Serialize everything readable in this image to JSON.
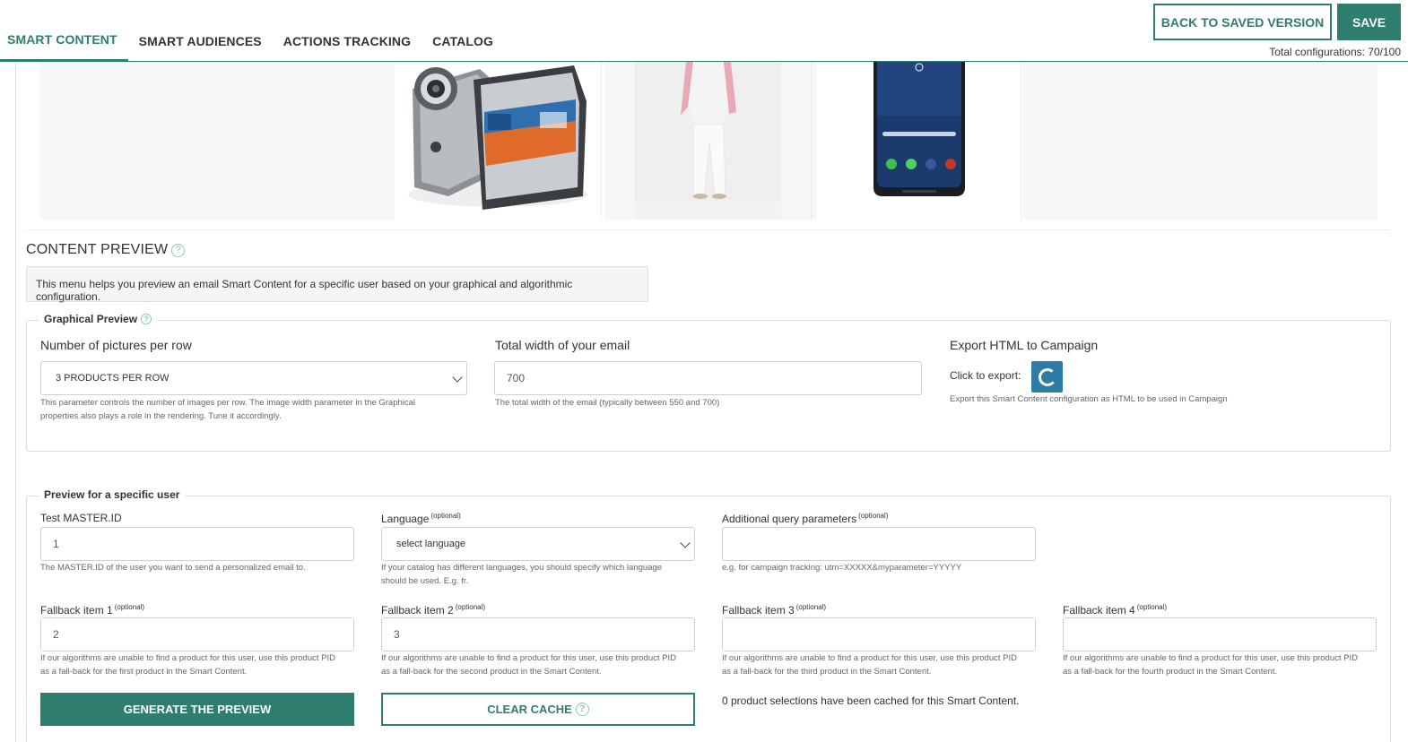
{
  "nav": {
    "tabs": [
      {
        "label": "SMART CONTENT",
        "active": true
      },
      {
        "label": "SMART AUDIENCES",
        "active": false
      },
      {
        "label": "ACTIONS TRACKING",
        "active": false
      },
      {
        "label": "CATALOG",
        "active": false
      }
    ],
    "back_label": "BACK TO SAVED VERSION",
    "save_label": "SAVE",
    "total_configurations": "Total configurations: 70/100"
  },
  "products": [
    {
      "name": "camcorder-image"
    },
    {
      "name": "fashion-model-image"
    },
    {
      "name": "smartphone-image"
    }
  ],
  "content_preview": {
    "title": "CONTENT PREVIEW",
    "info": "This menu helps you preview an email Smart Content for a specific user based on your graphical and algorithmic configuration."
  },
  "graphical_preview": {
    "legend": "Graphical Preview",
    "pictures_label": "Number of pictures per row",
    "pictures_value": "3 PRODUCTS PER ROW",
    "pictures_hint_1": "This parameter controls the number of images per row. The image width parameter in the Graphical",
    "pictures_hint_2": "properties also plays a role in the rendering. Tune it accordingly.",
    "width_label": "Total width of your email",
    "width_value": "700",
    "width_hint": "The total width of the email (typically between 550 and 700)",
    "export_label": "Export HTML to Campaign",
    "click_label": "Click to export:",
    "export_hint": "Export this Smart Content configuration as HTML to be used in Campaign"
  },
  "user_preview": {
    "legend": "Preview for a specific user",
    "optional": "(optional)",
    "master_label": "Test MASTER.ID",
    "master_value": "1",
    "master_hint": "The MASTER.ID of the user you want to send a personalized email to.",
    "language_label": "Language",
    "language_value": "select language",
    "language_hint_1": "If your catalog has different languages, you should specify which language",
    "language_hint_2": "should be used. E.g. fr.",
    "query_label": "Additional query parameters",
    "query_value": "",
    "query_hint": "e.g. for campaign tracking: utm=XXXXX&myparameter=YYYYY",
    "fallbacks": [
      {
        "label": "Fallback item 1",
        "value": "2",
        "hint_1": "If our algorithms are unable to find a product for this user, use this product PID",
        "hint_2": "as a fall-back for the first product in the Smart Content."
      },
      {
        "label": "Fallback item 2",
        "value": "3",
        "hint_1": "If our algorithms are unable to find a product for this user, use this product PID",
        "hint_2": "as a fall-back for the second product in the Smart Content."
      },
      {
        "label": "Fallback item 3",
        "value": "",
        "hint_1": "If our algorithms are unable to find a product for this user, use this product PID",
        "hint_2": "as a fall-back for the third product in the Smart Content."
      },
      {
        "label": "Fallback item 4",
        "value": "",
        "hint_1": "If our algorithms are unable to find a product for this user, use this product PID",
        "hint_2": "as a fall-back for the fourth product in the Smart Content."
      }
    ],
    "generate_label": "GENERATE THE PREVIEW",
    "clear_label": "CLEAR CACHE",
    "cache_status": "0 product selections have been cached for this Smart Content."
  },
  "colors": {
    "accent": "#2e7d6f",
    "export_icon": "#2e7ba6"
  }
}
